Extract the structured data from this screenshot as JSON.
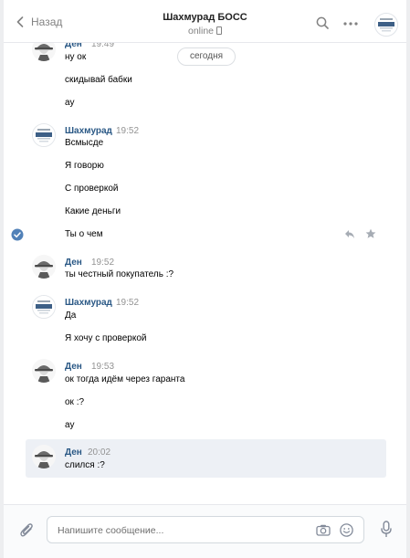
{
  "header": {
    "back_label": "Назад",
    "chat_title": "Шахмурад БОСС",
    "status": "online"
  },
  "date_separator": "сегодня",
  "users": {
    "den": "Ден",
    "boss": "Шахмурад"
  },
  "messages": {
    "g1": {
      "time": "19:49",
      "lines": [
        "ну ок",
        "скидывай бабки",
        "ау"
      ]
    },
    "g2": {
      "time": "19:52",
      "lines": [
        "Всмысде",
        "Я говорю",
        "С проверкой",
        "Какие деньги",
        "Ты о чем"
      ]
    },
    "g3": {
      "time": "19:52",
      "lines": [
        "ты честный покупатель :?"
      ]
    },
    "g4": {
      "time": "19:52",
      "lines": [
        "Да",
        "Я хочу с проверкой"
      ]
    },
    "g5": {
      "time": "19:53",
      "lines": [
        "ок тогда идём через гаранта",
        "ок :?",
        "ау"
      ]
    },
    "g6": {
      "time": "20:02",
      "lines": [
        "слился :?"
      ]
    }
  },
  "composer": {
    "placeholder": "Напишите сообщение..."
  },
  "colors": {
    "link": "#2a5885",
    "accent": "#5181b8",
    "muted": "#939393",
    "highlight": "#edf0f5"
  },
  "icons": [
    "chevron-left-icon",
    "search-icon",
    "more-icon",
    "check-circle-icon",
    "reply-icon",
    "star-icon",
    "paperclip-icon",
    "camera-icon",
    "smile-icon",
    "microphone-icon"
  ]
}
